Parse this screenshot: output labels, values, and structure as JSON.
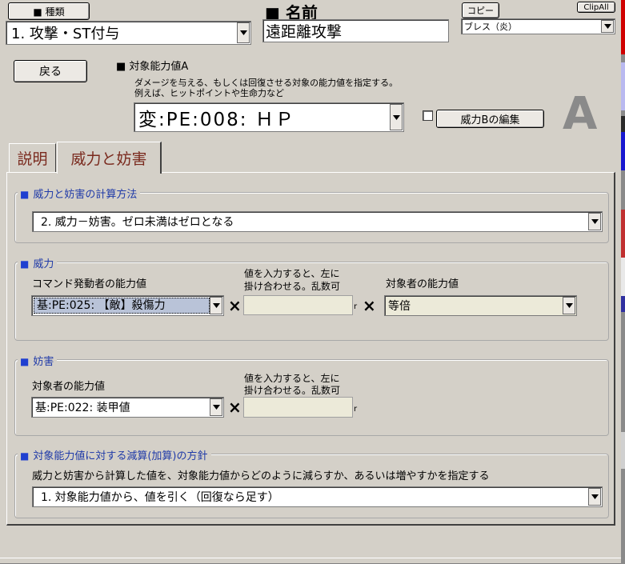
{
  "header": {
    "type_button_label": "■ 種類",
    "type_combo_value": "1. 攻撃・ST付与",
    "name_heading": "■ 名前",
    "name_value": "遠距離攻撃",
    "copy_button_label": "コピー",
    "clipall_button_label": "ClipAll",
    "template_combo_value": "ブレス（炎）"
  },
  "target_a": {
    "back_button_label": "戻る",
    "heading": "■ 対象能力値A",
    "desc_line1": "ダメージを与える、もしくは回復させる対象の能力値を指定する。",
    "desc_line2": "例えば、ヒットポイントや生命力など",
    "combo_value": "変:PE:008: ＨＰ",
    "edit_b_button_label": "威力Bの編集",
    "big_letter": "A"
  },
  "tabs": [
    {
      "label": "説明"
    },
    {
      "label": "威力と妨害"
    }
  ],
  "calc_method": {
    "title": "威力と妨害の計算方法",
    "combo_value": "2. 威力－妨害。ゼロ未満はゼロとなる"
  },
  "power": {
    "title": "威力",
    "caster_label": "コマンド発動者の能力値",
    "caster_combo_value": "基:PE:025: 【敵】殺傷力",
    "input_note_line1": "値を入力すると、左に",
    "input_note_line2": "掛け合わせる。乱数可",
    "r_mark": "r",
    "times_symbol": "×",
    "target_label": "対象者の能力値",
    "target_combo_value": "等倍"
  },
  "defense": {
    "title": "妨害",
    "target_label": "対象者の能力値",
    "target_combo_value": "基:PE:022: 装甲値",
    "input_note_line1": "値を入力すると、左に",
    "input_note_line2": "掛け合わせる。乱数可",
    "r_mark": "r",
    "times_symbol": "×"
  },
  "policy": {
    "title": "対象能力値に対する減算(加算)の方針",
    "desc": "威力と妨害から計算した値を、対象能力値からどのように減らすか、あるいは増やすかを指定する",
    "combo_value": "1. 対象能力値から、値を引く（回復なら足す）"
  },
  "colors": {
    "background": "#d4d0c8",
    "group_title": "#1f3aa8",
    "bullet": "#1f3fd0",
    "tab_text": "#7a2a1e",
    "big_letter": "#8a8a8a",
    "empty_input": "#ecead9",
    "selected_item": "#3a6ea5"
  }
}
